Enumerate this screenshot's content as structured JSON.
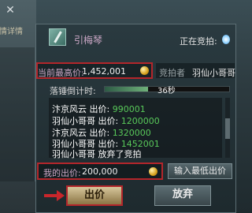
{
  "window": {
    "close_icon": "close-icon",
    "side_tab": "情详情"
  },
  "item": {
    "name": "引梅琴",
    "icon": "item-icon"
  },
  "status": {
    "label": "正在竞拍:",
    "icon": "orb-icon"
  },
  "current_bid": {
    "label": "当前最高价:",
    "value": "1,452,001"
  },
  "bidder": {
    "label": "竞拍者",
    "value": "羽仙小哥哥"
  },
  "countdown": {
    "label": "落锤倒计时:",
    "value": "36秒",
    "progress": 0.35
  },
  "log": [
    {
      "who": "汴京风云 出价:",
      "amount": "990001"
    },
    {
      "who": "羽仙小哥哥 出价:",
      "amount": "1200000"
    },
    {
      "who": "汴京风云 出价:",
      "amount": "1320000"
    },
    {
      "who": "羽仙小哥哥 出价:",
      "amount": "1452001"
    },
    {
      "who": "羽仙小哥哥 放弃了竞拍",
      "amount": ""
    }
  ],
  "my_bid": {
    "label": "我的出价:",
    "value": "200,000"
  },
  "buttons": {
    "min_price": "输入最低出价",
    "bid": "出价",
    "cancel": "放弃"
  },
  "colors": {
    "highlight_red": "#b3262b",
    "bid_green": "#59c95a",
    "item_pink": "#c9a6c4"
  }
}
